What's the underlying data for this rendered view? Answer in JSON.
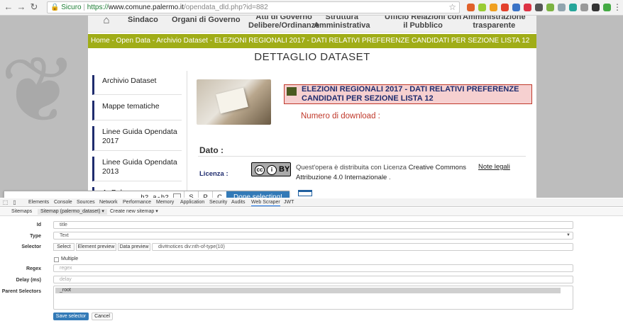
{
  "browser": {
    "secure_label": "Sicuro",
    "url_scheme": "https://",
    "url_host": "www.comune.palermo.it",
    "url_path": "/opendata_dld.php?id=882",
    "extension_colors": [
      "#e0612a",
      "#9c3",
      "#f0a020",
      "#e3412c",
      "#3a73c6",
      "#d34",
      "#555",
      "#7cb342",
      "#90a4ae",
      "#26a69a",
      "#999",
      "#333",
      "#4a4"
    ]
  },
  "site": {
    "nav": [
      {
        "label": "Sindaco"
      },
      {
        "label": "Organi di Governo"
      },
      {
        "label": "Atti di Governo\nDelibere/Ordinanze"
      },
      {
        "label": "Struttura\nAmministrativa"
      },
      {
        "label": "Ufficio Relazioni con\nil Pubblico"
      },
      {
        "label": "Amministrazione\ntrasparente"
      }
    ],
    "breadcrumb": "Home - Open Data - Archivio Dataset - ELEZIONI REGIONALI 2017 - DATI RELATIVI PREFERENZE CANDIDATI PER SEZIONE LISTA 12",
    "page_title": "DETTAGLIO DATASET",
    "sidebar": [
      {
        "label": "Archivio Dataset"
      },
      {
        "label": "Mappe tematiche"
      },
      {
        "label": "Linee Guida Opendata 2017"
      },
      {
        "label": "Linee Guida Opendata 2013"
      },
      {
        "label": "ApPalermo"
      }
    ],
    "dataset_title": "ELEZIONI REGIONALI 2017 - DATI RELATIVI PREFERENZE CANDIDATI PER SEZIONE LISTA 12",
    "downloads_label": "Numero di download :",
    "dato_label": "Dato :",
    "licenza_label": "Licenza :",
    "cc_badge": "BY",
    "license_text_prefix": "Quest'opera è distribuita con Licenza ",
    "license_link": "Creative Commons Attribuzione 4.0 Internazionale",
    "license_text_suffix": " .",
    "note_legali": "Note legali"
  },
  "webscraper_toolbar": {
    "selector": "h2.a-h2",
    "key_s": "S",
    "key_p": "P",
    "key_c": "C",
    "done_label": "Done selecting!"
  },
  "devtools": {
    "tabs": [
      "Elements",
      "Console",
      "Sources",
      "Network",
      "Performance",
      "Memory",
      "Application",
      "Security",
      "Audits",
      "Web Scraper",
      "JWT"
    ],
    "active_tab": "Web Scraper",
    "subnav": {
      "sitemaps": "Sitemaps",
      "current_sitemap": "Sitemap (palermo_dataset) ▾",
      "create": "Create new sitemap ▾"
    },
    "form": {
      "id_label": "Id",
      "id_value": "title",
      "type_label": "Type",
      "type_value": "Text",
      "selector_label": "Selector",
      "select_btn": "Select",
      "element_preview_btn": "Element preview",
      "data_preview_btn": "Data preview",
      "selector_value": "div#notices div:nth-of-type(10)",
      "multiple_label": "Multiple",
      "regex_label": "Regex",
      "regex_placeholder": "regex",
      "delay_label": "Delay (ms)",
      "delay_placeholder": "delay",
      "parent_label": "Parent Selectors",
      "parent_value": "_root",
      "save_btn": "Save selector",
      "cancel_btn": "Cancel"
    }
  }
}
